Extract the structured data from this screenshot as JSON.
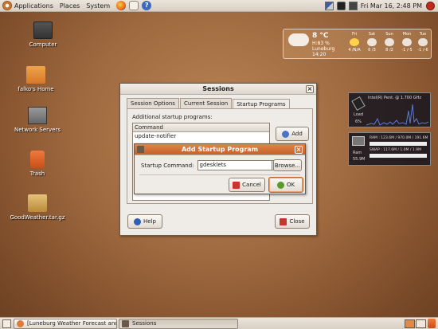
{
  "top_panel": {
    "menus": [
      "Applications",
      "Places",
      "System"
    ],
    "clock": "Fri Mar 16,  2:48 PM"
  },
  "desktop_icons": [
    {
      "label": "Computer"
    },
    {
      "label": "falko's Home"
    },
    {
      "label": "Network Servers"
    },
    {
      "label": "Trash"
    },
    {
      "label": "GoodWeather.tar.gz"
    }
  ],
  "weather": {
    "temp": "8 °C",
    "humidity": "H:83 %",
    "city": "Luneburg",
    "time": "14:20",
    "days": [
      {
        "name": "Fri",
        "range": "4 /N/A"
      },
      {
        "name": "Sat",
        "range": "6 /3"
      },
      {
        "name": "Sun",
        "range": "8 /2"
      },
      {
        "name": "Mon",
        "range": "-1 /-5"
      },
      {
        "name": "Tue",
        "range": "-1 /-6"
      }
    ]
  },
  "cpu": {
    "title": "Intel(R) Pent. @ 1.700 GHz",
    "load_label": "Load",
    "load_value": "6%"
  },
  "ram": {
    "ram_line": "RAM : 123.6M / 970.0M / 191.6M",
    "swap_line": "SWAP : 117.6M / 1.0M / 1.9M",
    "ram_label": "Ram",
    "ram_value": "55.9M"
  },
  "sessions": {
    "title": "Sessions",
    "tabs": [
      "Session Options",
      "Current Session",
      "Startup Programs"
    ],
    "section_label": "Additional startup programs:",
    "list_header": "Command",
    "programs": [
      "update-notifier"
    ],
    "add_label": "Add",
    "help_label": "Help",
    "close_label": "Close"
  },
  "add_dialog": {
    "title": "Add Startup Program",
    "command_label": "Startup Command:",
    "command_value": "gdesklets",
    "browse_label": "Browse...",
    "cancel_label": "Cancel",
    "ok_label": "OK"
  },
  "taskbar": {
    "tasks": [
      "[Luneburg Weather Forecast and ...",
      "Sessions"
    ]
  }
}
